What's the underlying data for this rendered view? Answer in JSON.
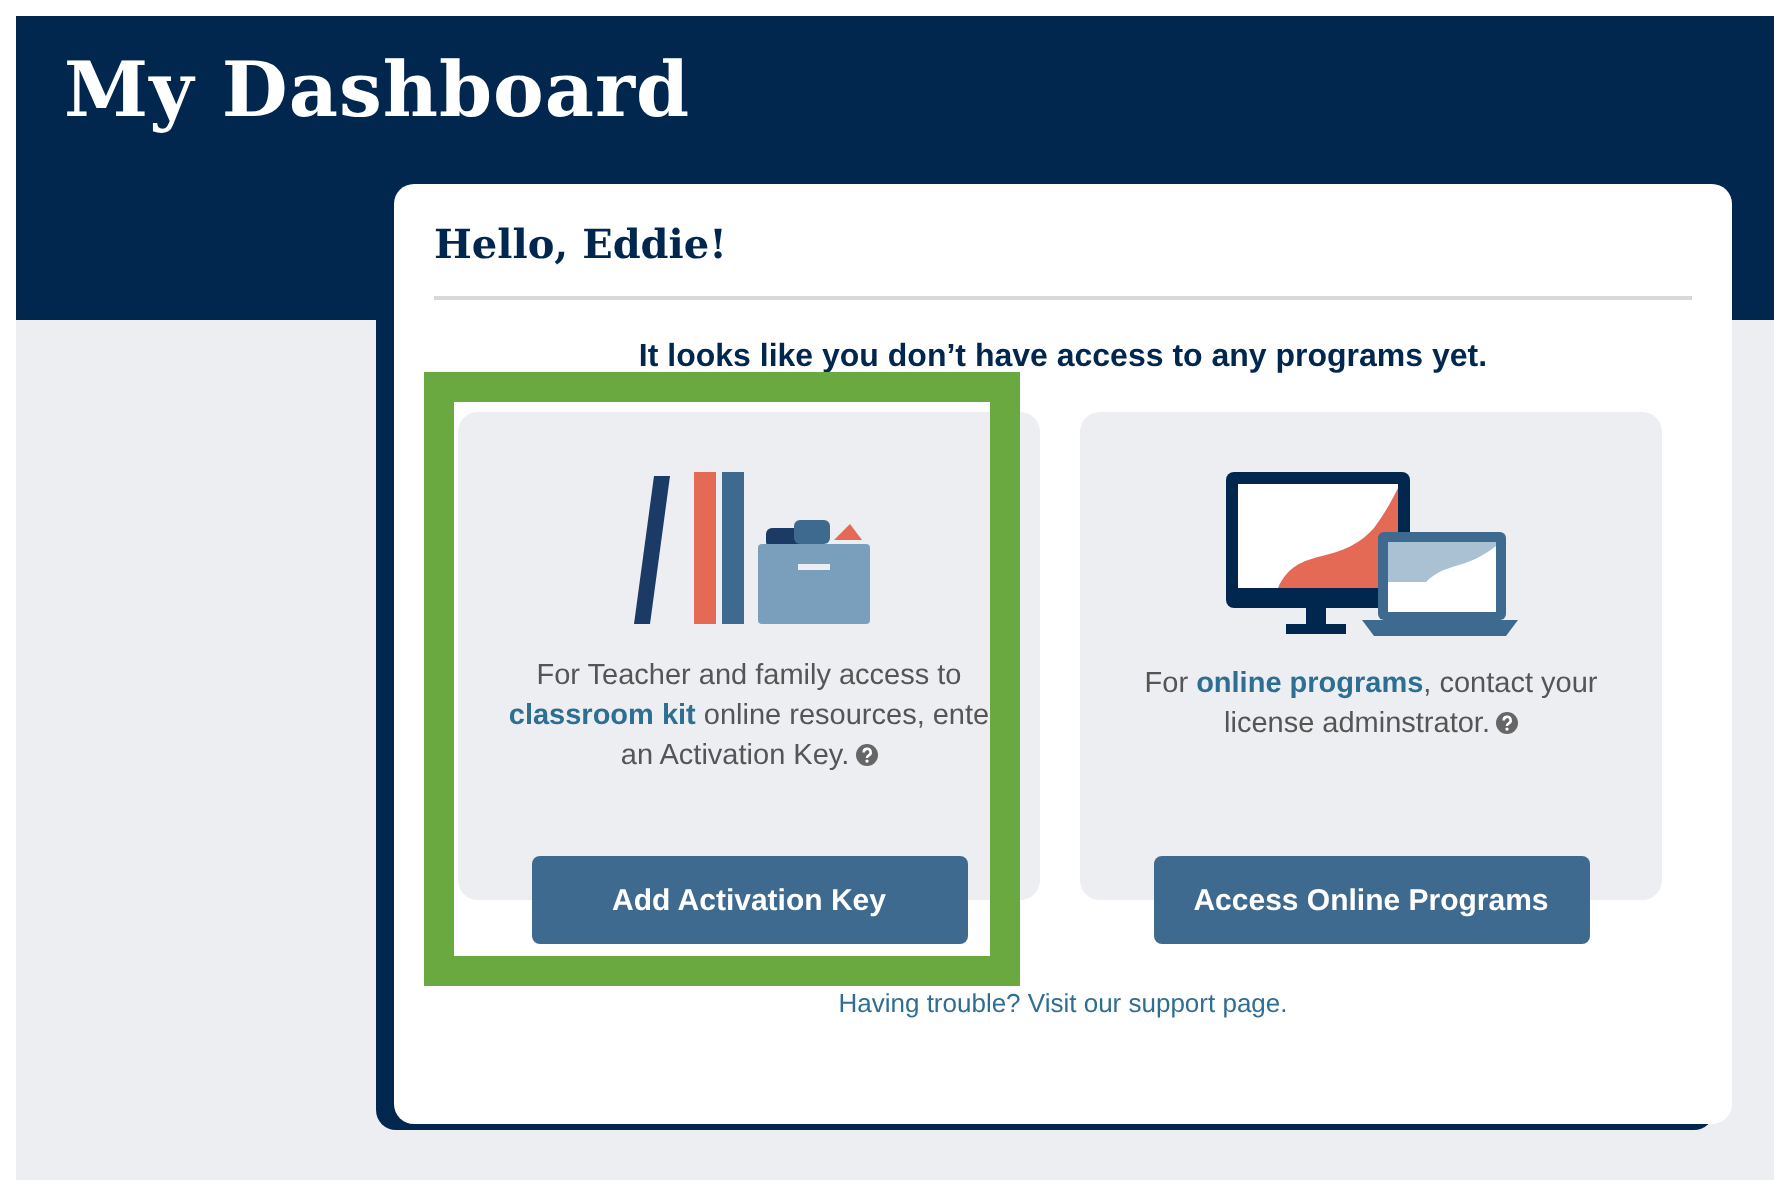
{
  "header": {
    "title": "My Dashboard"
  },
  "card": {
    "greeting": "Hello, Eddie!",
    "notice": "It looks like you don’t have access to any programs yet.",
    "options": [
      {
        "kind": "kit",
        "text_before": "For Teacher and family access to",
        "link": "classroom kit",
        "text_after": "online resources, ente an Activation Key.",
        "button": "Add Activation Key",
        "highlighted": true
      },
      {
        "kind": "online",
        "text_before": "For",
        "link": "online programs",
        "text_after": ", contact your license adminstrator.",
        "button": "Access Online Programs",
        "highlighted": false
      }
    ],
    "footer": "Having trouble? Visit our support page."
  }
}
